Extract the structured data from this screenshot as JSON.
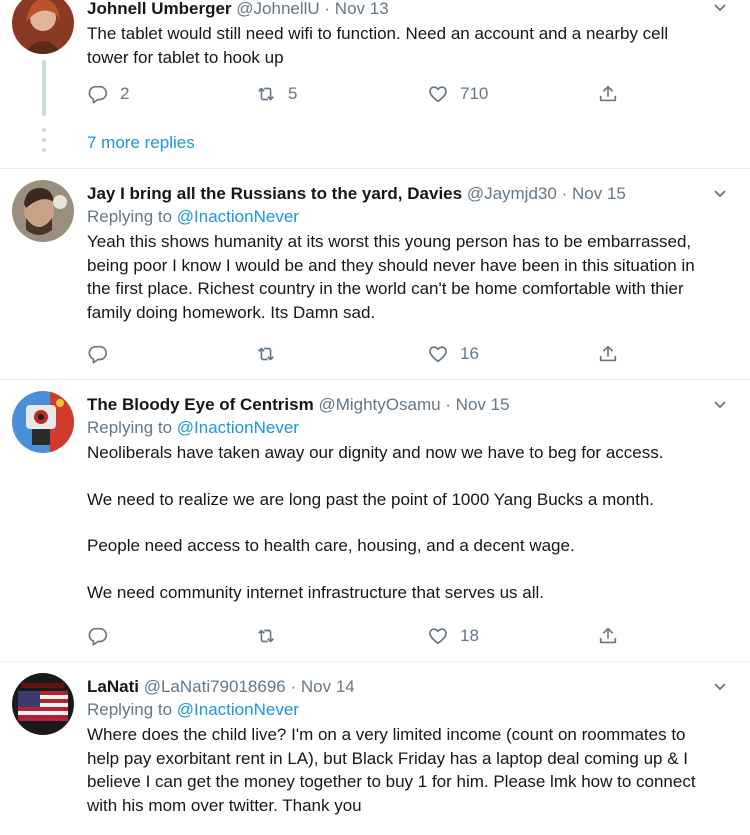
{
  "tweets": [
    {
      "display_name": "Johnell Umberger",
      "handle": "@JohnellU",
      "date": "· Nov 13",
      "text": "The tablet would still need wifi to function. Need an account and a nearby cell tower for tablet to hook up",
      "replies": "2",
      "retweets": "5",
      "likes": "710",
      "more_replies": "7 more replies"
    },
    {
      "display_name": "Jay I bring all the Russians to the yard, Davies",
      "handle": "@Jaymjd30",
      "date": "· Nov 15",
      "replying_label": "Replying to",
      "replying_to": "@InactionNever",
      "text": "Yeah this shows humanity at its worst this young person has to be embarrassed, being poor I know I would be and they should never have been in this situation in the first place. Richest country in the world can't be home comfortable with thier family doing homework. Its Damn sad.",
      "likes": "16"
    },
    {
      "display_name": "The Bloody Eye of Centrism",
      "handle": "@MightyOsamu",
      "date": "· Nov 15",
      "replying_label": "Replying to",
      "replying_to": "@InactionNever",
      "paragraphs": [
        "Neoliberals have taken away our dignity and now we have to beg for access.",
        "We need to realize we are long past the point of 1000 Yang Bucks a month.",
        "People need access to health care, housing, and a decent wage.",
        "We need community internet infrastructure that serves us all."
      ],
      "likes": "18"
    },
    {
      "display_name": "LaNati",
      "handle": "@LaNati79018696",
      "date": "· Nov 14",
      "replying_label": "Replying to",
      "replying_to": "@InactionNever",
      "text": "Where does the child live? I'm on a very limited income (count on roommates to help pay exorbitant rent in LA), but Black Friday has a laptop deal coming up & I believe I can get the money together to buy 1 for him. Please lmk how to connect with his mom over twitter. Thank you"
    }
  ],
  "colors": {
    "accent": "#1b95e0",
    "muted": "#657786",
    "text": "#14171a",
    "border": "#e6ecf0"
  },
  "icons": [
    "reply-icon",
    "retweet-icon",
    "like-icon",
    "share-icon",
    "chevron-down-icon"
  ]
}
